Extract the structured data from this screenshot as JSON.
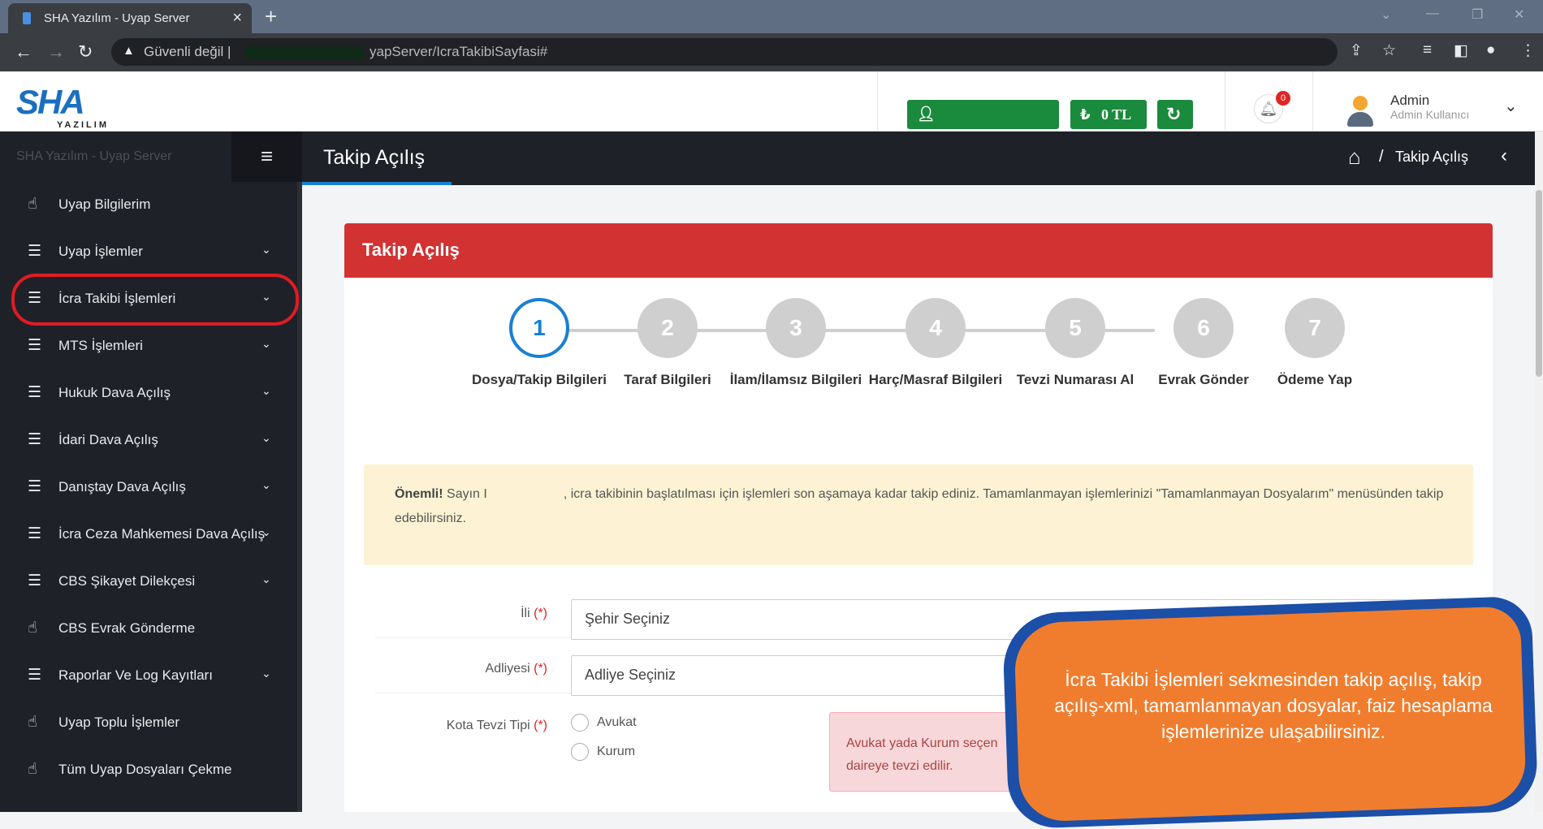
{
  "browser": {
    "tab_title": "SHA Yazılım - Uyap Server",
    "security_label": "Güvenli değil |",
    "url_visible": "yapServer/IcraTakibiSayfasi#"
  },
  "header": {
    "logo_text": "SHA",
    "logo_sub": "YAZILIM",
    "balance": "0 TL",
    "notification_count": "0",
    "user_name": "Admin",
    "user_role": "Admin Kullanıcı"
  },
  "sidebar": {
    "brand": "SHA Yazılım - Uyap Server",
    "items": [
      {
        "label": "Uyap Bilgilerim",
        "icon": "hand-pointer-icon",
        "has_submenu": false
      },
      {
        "label": "Uyap İşlemler",
        "icon": "stack-icon",
        "has_submenu": true
      },
      {
        "label": "İcra Takibi İşlemleri",
        "icon": "stack-icon",
        "has_submenu": true
      },
      {
        "label": "MTS İşlemleri",
        "icon": "stack-icon",
        "has_submenu": true
      },
      {
        "label": "Hukuk Dava Açılış",
        "icon": "stack-icon",
        "has_submenu": true
      },
      {
        "label": "İdari Dava Açılış",
        "icon": "stack-icon",
        "has_submenu": true
      },
      {
        "label": "Danıştay Dava Açılış",
        "icon": "stack-icon",
        "has_submenu": true
      },
      {
        "label": "İcra Ceza Mahkemesi Dava Açılış",
        "icon": "stack-icon",
        "has_submenu": true
      },
      {
        "label": "CBS Şikayet Dilekçesi",
        "icon": "stack-icon",
        "has_submenu": true
      },
      {
        "label": "CBS Evrak Gönderme",
        "icon": "hand-pointer-icon",
        "has_submenu": false
      },
      {
        "label": "Raporlar Ve Log Kayıtları",
        "icon": "stack-icon",
        "has_submenu": true
      },
      {
        "label": "Uyap Toplu İşlemler",
        "icon": "hand-pointer-icon",
        "has_submenu": false
      },
      {
        "label": "Tüm Uyap Dosyaları Çekme",
        "icon": "hand-pointer-icon",
        "has_submenu": false
      }
    ]
  },
  "page": {
    "title": "Takip Açılış",
    "breadcrumb_sep": "/",
    "breadcrumb_current": "Takip Açılış"
  },
  "card": {
    "title": "Takip Açılış",
    "steps": [
      {
        "num": "1",
        "label": "Dosya/Takip Bilgileri",
        "active": true
      },
      {
        "num": "2",
        "label": "Taraf Bilgileri",
        "active": false
      },
      {
        "num": "3",
        "label": "İlam/İlamsız Bilgileri",
        "active": false
      },
      {
        "num": "4",
        "label": "Harç/Masraf Bilgileri",
        "active": false
      },
      {
        "num": "5",
        "label": "Tevzi Numarası Al",
        "active": false
      },
      {
        "num": "6",
        "label": "Evrak Gönder",
        "active": false
      },
      {
        "num": "7",
        "label": "Ödeme Yap",
        "active": false
      }
    ],
    "notice_bold": "Önemli!",
    "notice_prefix": "Sayın I",
    "notice_text": ", icra takibinin başlatılması için işlemleri son aşamaya kadar takip ediniz. Tamamlanmayan işlemlerinizi \"Tamamlanmayan Dosyalarım\" menüsünden takip edebilirsiniz.",
    "form": {
      "il_label": "İli",
      "il_placeholder": "Şehir Seçiniz",
      "adliye_label": "Adliyesi",
      "adliye_placeholder": "Adliye Seçiniz",
      "kota_label": "Kota Tevzi Tipi",
      "req_mark": "(*)",
      "radio_avukat": "Avukat",
      "radio_kurum": "Kurum",
      "alert_text": "Avukat yada Kurum seçen daireye tevzi edilir."
    }
  },
  "callout": {
    "text": "İcra Takibi İşlemleri sekmesinden takip açılış, takip açılış-xml, tamamlanmayan dosyalar, faiz hesaplama işlemlerinize ulaşabilirsiniz."
  },
  "colors": {
    "accent_blue": "#1a7fd4",
    "header_red": "#d23232",
    "success_green": "#1a8a3c",
    "highlight_red": "#e01b24",
    "callout_orange": "#f07d2e",
    "callout_border": "#1b4fa8"
  }
}
